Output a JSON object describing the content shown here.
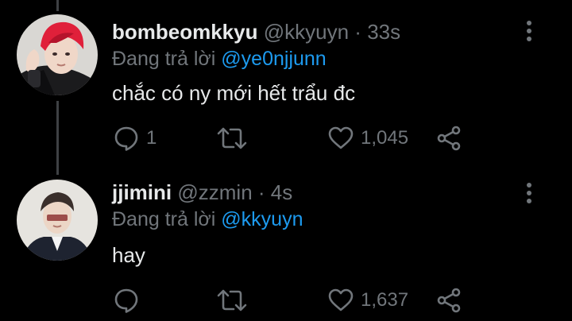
{
  "colors": {
    "background": "#000000",
    "text": "#e7e9ea",
    "muted": "#71767b",
    "accent": "#1d9bf0",
    "thread_line": "#3e4144"
  },
  "tweets": [
    {
      "display_name": "bombeomkkyu",
      "handle": "@kkyuyn",
      "separator": "·",
      "time": "33s",
      "replying_prefix": "Đang trả lời",
      "replying_to": "@ye0njjunn",
      "text": "chắc có ny mới hết trẩu đc",
      "reply_count": "1",
      "like_count": "1,045",
      "icons": [
        "reply-icon",
        "retweet-icon",
        "like-icon",
        "share-icon",
        "more-icon"
      ]
    },
    {
      "display_name": "jjimini",
      "handle": "@zzmin",
      "separator": "·",
      "time": "4s",
      "replying_prefix": "Đang trả lời",
      "replying_to": "@kkyuyn",
      "text": "hay",
      "reply_count": "",
      "like_count": "1,637",
      "icons": [
        "reply-icon",
        "retweet-icon",
        "like-icon",
        "share-icon",
        "more-icon"
      ]
    }
  ]
}
